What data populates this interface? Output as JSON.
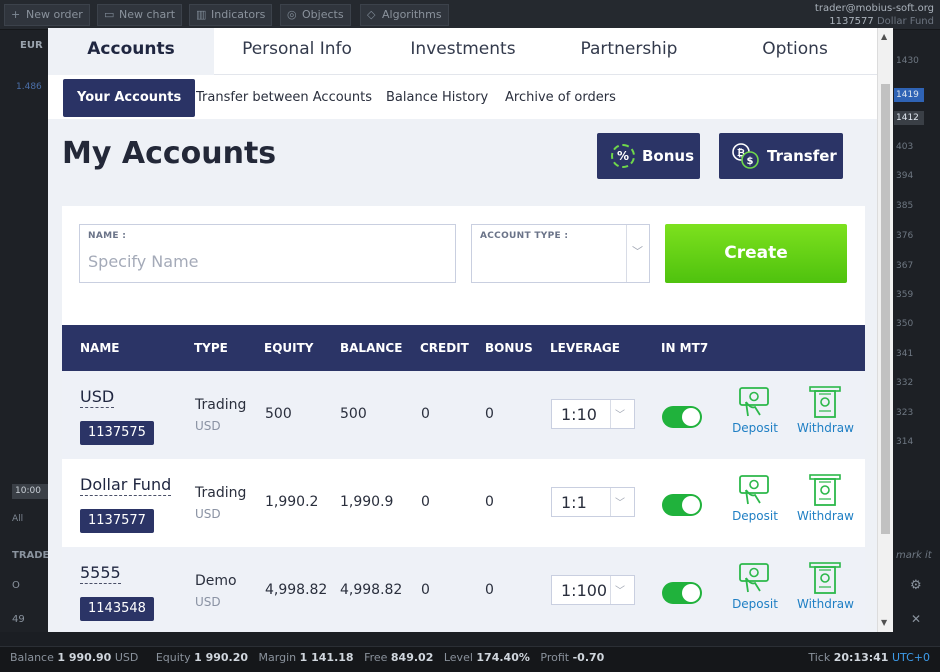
{
  "platform": {
    "toolbar": [
      {
        "label": "New order",
        "glyph": "+"
      },
      {
        "label": "New chart",
        "glyph": "▭"
      },
      {
        "label": "Indicators",
        "glyph": "▥"
      },
      {
        "label": "Objects",
        "glyph": "◎"
      },
      {
        "label": "Algorithms",
        "glyph": "◇"
      }
    ],
    "user_email": "trader@mobius-soft.org",
    "user_account": "1137577",
    "user_account_name": "Dollar Fund",
    "symbol": "EUR",
    "price_hint": "1.486",
    "time_label": "10:00",
    "all_label": "All",
    "trade_label": "TRADE",
    "row1_label": "O",
    "row2_label": "49",
    "mark_label": "mark it",
    "scale_ticks": [
      "1430",
      "1419",
      "1412",
      "403",
      "394",
      "385",
      "376",
      "367",
      "359",
      "350",
      "341",
      "332",
      "323",
      "314"
    ],
    "status": {
      "balance_label": "Balance",
      "balance_value": "1 990.90",
      "balance_ccy": "USD",
      "equity_label": "Equity",
      "equity_value": "1 990.20",
      "margin_label": "Margin",
      "margin_value": "1 141.18",
      "free_label": "Free",
      "free_value": "849.02",
      "level_label": "Level",
      "level_value": "174.40%",
      "profit_label": "Profit",
      "profit_value": "-0.70",
      "tick_label": "Tick",
      "tick_time": "20:13:41",
      "tz": "UTC+0"
    }
  },
  "main_tabs": [
    "Accounts",
    "Personal Info",
    "Investments",
    "Partnership",
    "Options"
  ],
  "sub_tabs": [
    "Your Accounts",
    "Transfer between Accounts",
    "Balance History",
    "Archive of orders"
  ],
  "page_title": "My Accounts",
  "buttons": {
    "bonus": "Bonus",
    "transfer": "Transfer",
    "create": "Create"
  },
  "form": {
    "name_label": "NAME :",
    "name_placeholder": "Specify Name",
    "type_label": "ACCOUNT TYPE :"
  },
  "table": {
    "headers": [
      "NAME",
      "TYPE",
      "EQUITY",
      "BALANCE",
      "CREDIT",
      "BONUS",
      "LEVERAGE",
      "IN MT7"
    ],
    "rows": [
      {
        "name": "USD",
        "id": "1137575",
        "type": "Trading",
        "currency": "USD",
        "equity": "500",
        "balance": "500",
        "credit": "0",
        "bonus": "0",
        "leverage": "1:10"
      },
      {
        "name": "Dollar Fund",
        "id": "1137577",
        "type": "Trading",
        "currency": "USD",
        "equity": "1,990.2",
        "balance": "1,990.9",
        "credit": "0",
        "bonus": "0",
        "leverage": "1:1"
      },
      {
        "name": "5555",
        "id": "1143548",
        "type": "Demo",
        "currency": "USD",
        "equity": "4,998.82",
        "balance": "4,998.82",
        "credit": "0",
        "bonus": "0",
        "leverage": "1:100"
      }
    ],
    "deposit_label": "Deposit",
    "withdraw_label": "Withdraw"
  },
  "colors": {
    "navy": "#2b3466",
    "create_green": "#5bd115",
    "toggle_green": "#20b23c",
    "link_blue": "#1f7fc4"
  }
}
